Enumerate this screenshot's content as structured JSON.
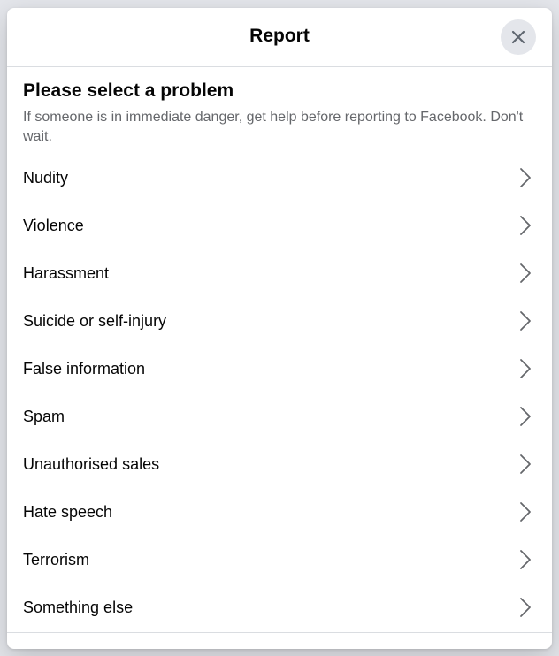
{
  "dialog": {
    "title": "Report",
    "close_icon": "close-icon"
  },
  "content": {
    "heading": "Please select a problem",
    "subtext": "If someone is in immediate danger, get help before reporting to Facebook. Don't wait."
  },
  "options": [
    {
      "label": "Nudity",
      "icon": "chevron-right-icon"
    },
    {
      "label": "Violence",
      "icon": "chevron-right-icon"
    },
    {
      "label": "Harassment",
      "icon": "chevron-right-icon"
    },
    {
      "label": "Suicide or self-injury",
      "icon": "chevron-right-icon"
    },
    {
      "label": "False information",
      "icon": "chevron-right-icon"
    },
    {
      "label": "Spam",
      "icon": "chevron-right-icon"
    },
    {
      "label": "Unauthorised sales",
      "icon": "chevron-right-icon"
    },
    {
      "label": "Hate speech",
      "icon": "chevron-right-icon"
    },
    {
      "label": "Terrorism",
      "icon": "chevron-right-icon"
    },
    {
      "label": "Something else",
      "icon": "chevron-right-icon"
    }
  ],
  "colors": {
    "primary_text": "#050505",
    "secondary_text": "#65676b",
    "close_bg": "#e4e6eb",
    "divider": "#dadde1"
  }
}
